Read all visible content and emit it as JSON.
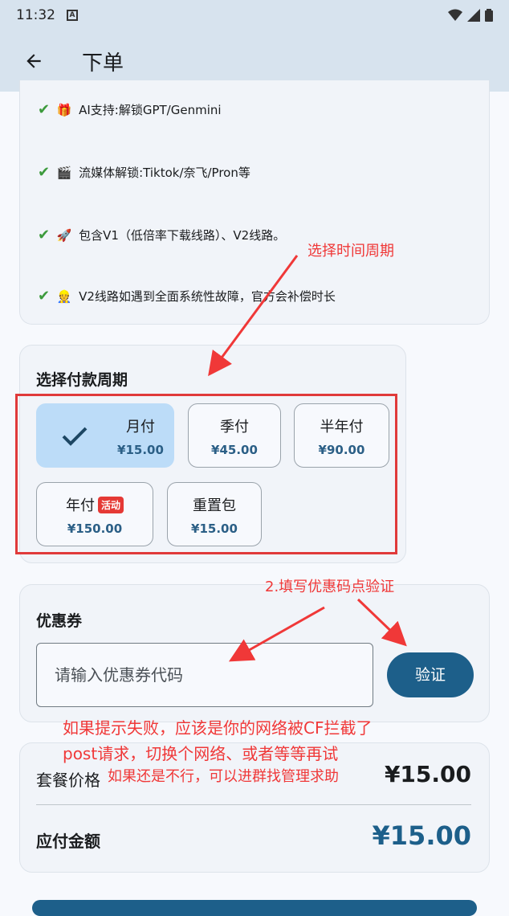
{
  "status_bar": {
    "time": "11:32",
    "app_icon": "A"
  },
  "app_bar": {
    "title": "下单"
  },
  "features": [
    {
      "emoji": "🎁",
      "text": "AI支持:解锁GPT/Genmini"
    },
    {
      "emoji": "🎬",
      "text": "流媒体解锁:Tiktok/奈飞/Pron等"
    },
    {
      "emoji": "🚀",
      "text": "包含V1（低倍率下载线路）、V2线路。"
    },
    {
      "emoji": "👷",
      "text": "V2线路如遇到全面系统性故障，官方会补偿时长"
    }
  ],
  "feature_check": "✔",
  "period": {
    "heading": "选择付款周期",
    "options": [
      {
        "name": "月付",
        "price": "¥15.00",
        "selected": true
      },
      {
        "name": "季付",
        "price": "¥45.00"
      },
      {
        "name": "半年付",
        "price": "¥90.00"
      },
      {
        "name": "年付",
        "price": "¥150.00",
        "badge": "活动"
      },
      {
        "name": "重置包",
        "price": "¥15.00"
      }
    ]
  },
  "coupon": {
    "heading": "优惠券",
    "placeholder": "请输入优惠券代码",
    "verify_label": "验证"
  },
  "summary": {
    "package_label": "套餐价格",
    "package_price": "¥15.00",
    "due_label": "应付金额",
    "due_price": "¥15.00"
  },
  "annotations": {
    "select_period": "选择时间周期",
    "fill_coupon": "2.填写优惠码点验证",
    "fail_line1": "如果提示失败，应该是你的网络被CF拦截了",
    "fail_line2": "post请求，切换个网络、或者等等再试",
    "help": "如果还是不行，可以进群找管理求助"
  },
  "colors": {
    "accent": "#1d5f8a",
    "selected": "#bcdcf8",
    "annotation": "#f03838",
    "app_bar": "#d7e3ee"
  }
}
